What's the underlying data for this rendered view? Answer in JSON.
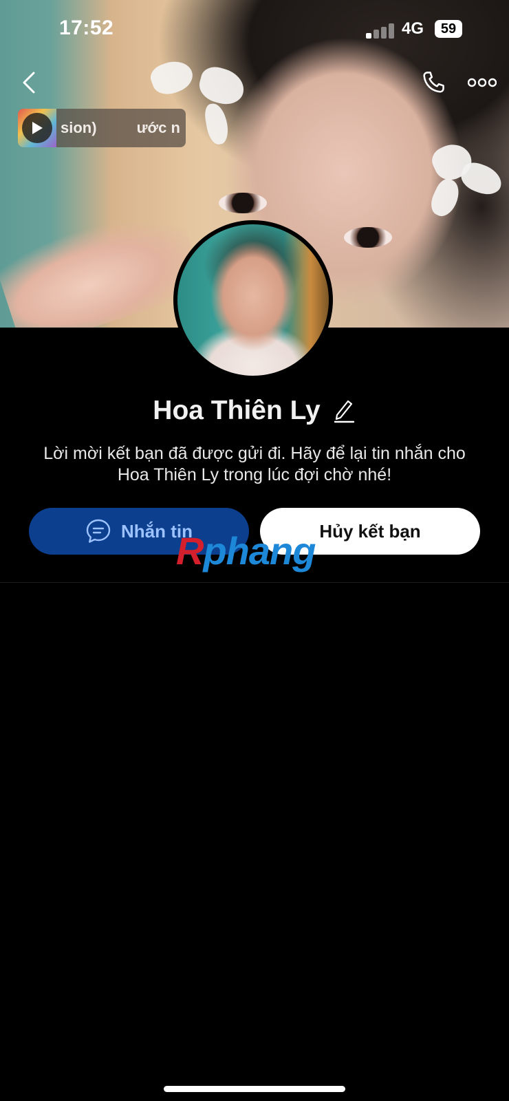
{
  "status_bar": {
    "time": "17:52",
    "network": "4G",
    "battery": "59"
  },
  "header": {
    "back_icon": "chevron-left-icon",
    "call_icon": "phone-icon",
    "more_icon": "more-horizontal-icon"
  },
  "music": {
    "play_icon": "play-icon",
    "text_1": "sion)",
    "text_2": "ước n"
  },
  "profile": {
    "name": "Hoa Thiên Ly",
    "edit_icon": "pencil-icon",
    "request_message": "Lời mời kết bạn đã được gửi đi. Hãy để lại tin nhắn cho Hoa Thiên Ly trong lúc đợi chờ nhé!"
  },
  "actions": {
    "message_label": "Nhắn tin",
    "message_icon": "chat-bubble-icon",
    "unfriend_label": "Hủy kết bạn"
  },
  "watermark": {
    "first": "R",
    "rest": "phang"
  },
  "colors": {
    "message_button_bg": "#0c3f8e",
    "message_button_text": "#9cc3ff",
    "background": "#000000"
  }
}
